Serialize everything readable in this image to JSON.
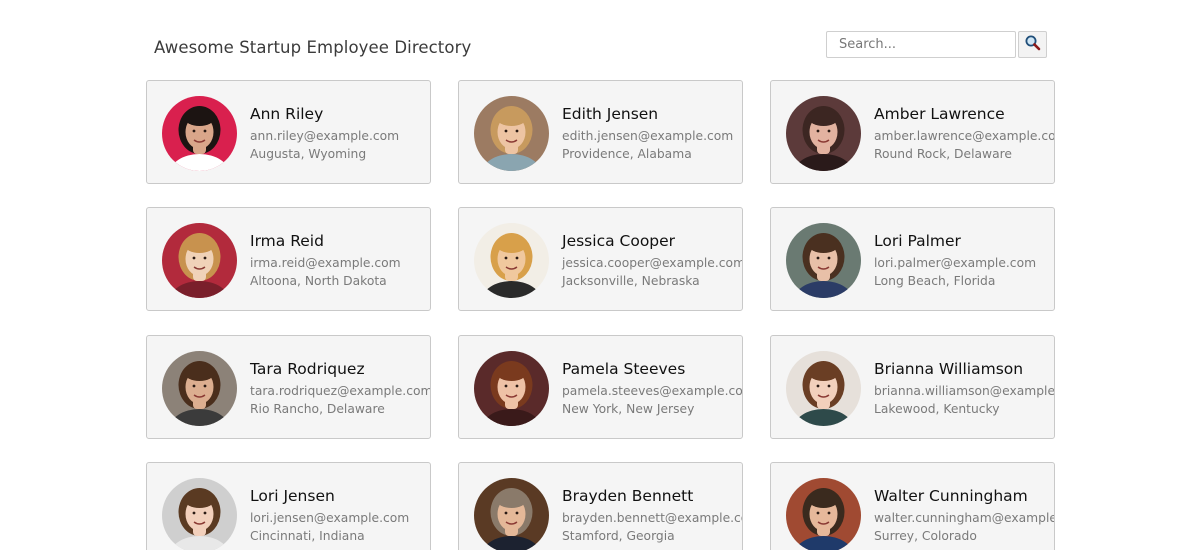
{
  "header": {
    "title": "Awesome Startup Employee Directory",
    "search_placeholder": "Search...",
    "search_icon": "magnifier-icon"
  },
  "employees": [
    {
      "name": "Ann Riley",
      "email": "ann.riley@example.com",
      "location": "Augusta, Wyoming",
      "bg": "#d9204e",
      "skin": "#d9a68a",
      "hair": "#1c1412",
      "shirt": "#ffffff"
    },
    {
      "name": "Edith Jensen",
      "email": "edith.jensen@example.com",
      "location": "Providence, Alabama",
      "bg": "#9c7b62",
      "skin": "#edc4a3",
      "hair": "#c79a5e",
      "shirt": "#8aa5b0"
    },
    {
      "name": "Amber Lawrence",
      "email": "amber.lawrence@example.com",
      "location": "Round Rock, Delaware",
      "bg": "#5c3a3a",
      "skin": "#e2b2a0",
      "hair": "#3c2622",
      "shirt": "#2a1a1a"
    },
    {
      "name": "Irma Reid",
      "email": "irma.reid@example.com",
      "location": "Altoona, North Dakota",
      "bg": "#b22a3c",
      "skin": "#f0d2b8",
      "hair": "#c8924e",
      "shirt": "#7a1f2b"
    },
    {
      "name": "Jessica Cooper",
      "email": "jessica.cooper@example.com",
      "location": "Jacksonville, Nebraska",
      "bg": "#f2eee6",
      "skin": "#f0c89e",
      "hair": "#d8a04a",
      "shirt": "#2a2a2a"
    },
    {
      "name": "Lori Palmer",
      "email": "lori.palmer@example.com",
      "location": "Long Beach, Florida",
      "bg": "#6a7a72",
      "skin": "#e8c0a8",
      "hair": "#4a3020",
      "shirt": "#2b3c66"
    },
    {
      "name": "Tara Rodriquez",
      "email": "tara.rodriquez@example.com",
      "location": "Rio Rancho, Delaware",
      "bg": "#8c8278",
      "skin": "#dcae90",
      "hair": "#4a2e1c",
      "shirt": "#3b3b3b"
    },
    {
      "name": "Pamela Steeves",
      "email": "pamela.steeves@example.com",
      "location": "New York, New Jersey",
      "bg": "#5a2a2a",
      "skin": "#eec2a6",
      "hair": "#7a3a1e",
      "shirt": "#3a1a1a"
    },
    {
      "name": "Brianna Williamson",
      "email": "brianna.williamson@example.com",
      "location": "Lakewood, Kentucky",
      "bg": "#e6e0da",
      "skin": "#f2d0bc",
      "hair": "#6a3e24",
      "shirt": "#2e4a4a"
    },
    {
      "name": "Lori Jensen",
      "email": "lori.jensen@example.com",
      "location": "Cincinnati, Indiana",
      "bg": "#cfcfcf",
      "skin": "#f2d0bc",
      "hair": "#5a3a22",
      "shirt": "#e8e8e8"
    },
    {
      "name": "Brayden Bennett",
      "email": "brayden.bennett@example.com",
      "location": "Stamford, Georgia",
      "bg": "#5a3a24",
      "skin": "#e4b898",
      "hair": "#8a7a6a",
      "shirt": "#1c2230"
    },
    {
      "name": "Walter Cunningham",
      "email": "walter.cunningham@example.com",
      "location": "Surrey, Colorado",
      "bg": "#a04a32",
      "skin": "#e6b89a",
      "hair": "#3a2a1e",
      "shirt": "#1f3a6a"
    }
  ]
}
